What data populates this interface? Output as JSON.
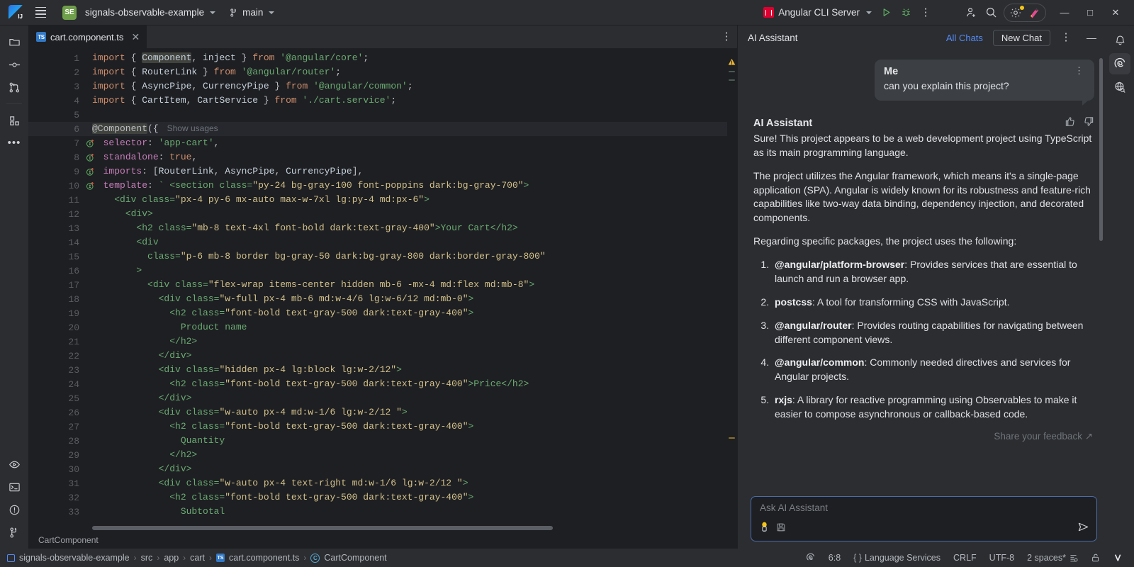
{
  "titlebar": {
    "logo_icon": "intellij-logo-icon",
    "menu_icon": "hamburger-menu-icon",
    "project_badge": "SE",
    "project_name": "signals-observable-example",
    "branch_icon": "git-branch-icon",
    "branch_name": "main",
    "run_config_icon": "angular-icon",
    "run_config": "Angular CLI Server",
    "run_icon": "run-play-icon",
    "debug_icon": "debug-bug-icon",
    "more_icon": "more-vertical-icon",
    "add_user_icon": "add-user-icon",
    "search_icon": "search-icon",
    "settings_icon": "gear-icon",
    "ai_icon": "ai-assistant-icon",
    "minimize": "—",
    "maximize": "□",
    "close": "✕"
  },
  "left_strip": {
    "items": [
      {
        "name": "project-tool-icon",
        "icon": "folder-icon"
      },
      {
        "name": "commit-tool-icon",
        "icon": "commit-node-icon"
      },
      {
        "name": "pull-requests-tool-icon",
        "icon": "pull-request-icon"
      },
      {
        "name": "structure-tool-icon",
        "icon": "structure-blocks-icon"
      },
      {
        "name": "more-tools-icon",
        "icon": "ellipsis-icon"
      }
    ],
    "bottom_items": [
      {
        "name": "run-tool-icon",
        "icon": "run-window-icon"
      },
      {
        "name": "terminal-tool-icon",
        "icon": "terminal-icon"
      },
      {
        "name": "problems-tool-icon",
        "icon": "warning-circle-icon"
      },
      {
        "name": "version-control-tool-icon",
        "icon": "branch-icon"
      }
    ]
  },
  "editor": {
    "tab": {
      "icon": "typescript-file-icon",
      "icon_label": "TS",
      "filename": "cart.component.ts",
      "close": "✕"
    },
    "tab_options_icon": "more-vertical-icon",
    "show_usages": "Show usages",
    "lines": [
      {
        "n": 1,
        "gutter": "",
        "html": "<span class='kw'>import</span><span class='punc'> { </span><span class='id comp-hl'>Component</span><span class='punc'>, </span><span class='id'>inject</span><span class='punc'> } </span><span class='kw'>from</span> <span class='str'>'@angular/core'</span><span class='punc'>;</span>"
      },
      {
        "n": 2,
        "gutter": "",
        "html": "<span class='kw'>import</span><span class='punc'> { </span><span class='id'>RouterLink</span><span class='punc'> } </span><span class='kw'>from</span> <span class='str'>'@angular/router'</span><span class='punc'>;</span>"
      },
      {
        "n": 3,
        "gutter": "",
        "html": "<span class='kw'>import</span><span class='punc'> { </span><span class='id'>AsyncPipe</span><span class='punc'>, </span><span class='id'>CurrencyPipe</span><span class='punc'> } </span><span class='kw'>from</span> <span class='str'>'@angular/common'</span><span class='punc'>;</span>"
      },
      {
        "n": 4,
        "gutter": "",
        "html": "<span class='kw'>import</span><span class='punc'> { </span><span class='id'>CartItem</span><span class='punc'>, </span><span class='id'>CartService</span><span class='punc'> } </span><span class='kw'>from</span> <span class='str'>'./cart.service'</span><span class='punc'>;</span>"
      },
      {
        "n": 5,
        "gutter": "",
        "html": ""
      },
      {
        "n": 6,
        "gutter": "",
        "html": "<span class='comp-hl' style='color:#bcbec4'>@Component</span><span class='punc'>({</span>",
        "usages": true,
        "highlight": true
      },
      {
        "n": 7,
        "gutter": "impl",
        "html": "  <span class='prop'>selector</span><span class='punc'>: </span><span class='str'>'app-cart'</span><span class='punc'>,</span>"
      },
      {
        "n": 8,
        "gutter": "impl",
        "html": "  <span class='prop'>standalone</span><span class='punc'>: </span><span class='kw'>true</span><span class='punc'>,</span>"
      },
      {
        "n": 9,
        "gutter": "impl",
        "html": "  <span class='prop'>imports</span><span class='punc'>: [</span><span class='id'>RouterLink</span><span class='punc'>, </span><span class='id'>AsyncPipe</span><span class='punc'>, </span><span class='id'>CurrencyPipe</span><span class='punc'>],</span>"
      },
      {
        "n": 10,
        "gutter": "impl",
        "html": "  <span class='prop'>template</span><span class='punc'>: </span><span class='str'>` </span><span class='tmpl'>&lt;section class=</span><span class='tmplattr'>\"py-24 bg-gray-100 font-poppins dark:bg-gray-700\"</span><span class='tmpl'>&gt;</span>"
      },
      {
        "n": 11,
        "gutter": "",
        "html": "    <span class='tmpl'>&lt;div class=</span><span class='tmplattr'>\"px-4 py-6 mx-auto max-w-7xl lg:py-4 md:px-6\"</span><span class='tmpl'>&gt;</span>"
      },
      {
        "n": 12,
        "gutter": "",
        "html": "      <span class='tmpl'>&lt;div&gt;</span>"
      },
      {
        "n": 13,
        "gutter": "",
        "html": "        <span class='tmpl'>&lt;h2 class=</span><span class='tmplattr'>\"mb-8 text-4xl font-bold dark:text-gray-400\"</span><span class='tmpl'>&gt;Your Cart&lt;/h2&gt;</span>"
      },
      {
        "n": 14,
        "gutter": "",
        "html": "        <span class='tmpl'>&lt;div</span>"
      },
      {
        "n": 15,
        "gutter": "",
        "html": "          <span class='tmpl'>class=</span><span class='tmplattr'>\"p-6 mb-8 border bg-gray-50 dark:bg-gray-800 dark:border-gray-800\"</span>"
      },
      {
        "n": 16,
        "gutter": "",
        "html": "        <span class='tmpl'>&gt;</span>"
      },
      {
        "n": 17,
        "gutter": "",
        "html": "          <span class='tmpl'>&lt;div class=</span><span class='tmplattr'>\"flex-wrap items-center hidden mb-6 -mx-4 md:flex md:mb-8\"</span><span class='tmpl'>&gt;</span>"
      },
      {
        "n": 18,
        "gutter": "",
        "html": "            <span class='tmpl'>&lt;div class=</span><span class='tmplattr'>\"w-full px-4 mb-6 md:w-4/6 lg:w-6/12 md:mb-0\"</span><span class='tmpl'>&gt;</span>"
      },
      {
        "n": 19,
        "gutter": "",
        "html": "              <span class='tmpl'>&lt;h2 class=</span><span class='tmplattr'>\"font-bold text-gray-500 dark:text-gray-400\"</span><span class='tmpl'>&gt;</span>"
      },
      {
        "n": 20,
        "gutter": "",
        "html": "                <span class='tmpl'>Product name</span>"
      },
      {
        "n": 21,
        "gutter": "",
        "html": "              <span class='tmpl'>&lt;/h2&gt;</span>"
      },
      {
        "n": 22,
        "gutter": "",
        "html": "            <span class='tmpl'>&lt;/div&gt;</span>"
      },
      {
        "n": 23,
        "gutter": "",
        "html": "            <span class='tmpl'>&lt;div class=</span><span class='tmplattr'>\"hidden px-4 lg:block lg:w-2/12\"</span><span class='tmpl'>&gt;</span>"
      },
      {
        "n": 24,
        "gutter": "",
        "html": "              <span class='tmpl'>&lt;h2 class=</span><span class='tmplattr'>\"font-bold text-gray-500 dark:text-gray-400\"</span><span class='tmpl'>&gt;Price&lt;/h2&gt;</span>"
      },
      {
        "n": 25,
        "gutter": "",
        "html": "            <span class='tmpl'>&lt;/div&gt;</span>"
      },
      {
        "n": 26,
        "gutter": "",
        "html": "            <span class='tmpl'>&lt;div class=</span><span class='tmplattr'>\"w-auto px-4 md:w-1/6 lg:w-2/12 \"</span><span class='tmpl'>&gt;</span>"
      },
      {
        "n": 27,
        "gutter": "",
        "html": "              <span class='tmpl'>&lt;h2 class=</span><span class='tmplattr'>\"font-bold text-gray-500 dark:text-gray-400\"</span><span class='tmpl'>&gt;</span>"
      },
      {
        "n": 28,
        "gutter": "",
        "html": "                <span class='tmpl'>Quantity</span>"
      },
      {
        "n": 29,
        "gutter": "",
        "html": "              <span class='tmpl'>&lt;/h2&gt;</span>"
      },
      {
        "n": 30,
        "gutter": "",
        "html": "            <span class='tmpl'>&lt;/div&gt;</span>"
      },
      {
        "n": 31,
        "gutter": "",
        "html": "            <span class='tmpl'>&lt;div class=</span><span class='tmplattr'>\"w-auto px-4 text-right md:w-1/6 lg:w-2/12 \"</span><span class='tmpl'>&gt;</span>"
      },
      {
        "n": 32,
        "gutter": "",
        "html": "              <span class='tmpl'>&lt;h2 class=</span><span class='tmplattr'>\"font-bold text-gray-500 dark:text-gray-400\"</span><span class='tmpl'>&gt;</span>"
      },
      {
        "n": 33,
        "gutter": "",
        "html": "                <span class='tmpl'>Subtotal</span>"
      }
    ],
    "breadcrumb_class": "CartComponent"
  },
  "ai": {
    "panel_title": "AI Assistant",
    "all_chats": "All Chats",
    "new_chat": "New Chat",
    "options_icon": "more-vertical-icon",
    "minimize_icon": "minimize-icon",
    "user_message": {
      "author": "Me",
      "text": "can you explain this project?",
      "options_icon": "more-vertical-icon"
    },
    "assistant": {
      "author": "AI Assistant",
      "thumbs_up_icon": "thumbs-up-icon",
      "thumbs_down_icon": "thumbs-down-icon",
      "paragraph1": "Sure! This project appears to be a web development project using TypeScript as its main programming language.",
      "paragraph2": "The project utilizes the Angular framework, which means it's a single-page application (SPA). Angular is widely known for its robustness and feature-rich capabilities like two-way data binding, dependency injection, and decorated components.",
      "paragraph3": "Regarding specific packages, the project uses the following:",
      "packages": [
        {
          "name": "@angular/platform-browser",
          "desc": ": Provides services that are essential to launch and run a browser app."
        },
        {
          "name": "postcss",
          "desc": ": A tool for transforming CSS with JavaScript."
        },
        {
          "name": "@angular/router",
          "desc": ": Provides routing capabilities for navigating between different component views."
        },
        {
          "name": "@angular/common",
          "desc": ": Commonly needed directives and services for Angular projects."
        },
        {
          "name": "rxjs",
          "desc": ": A library for reactive programming using Observables to make it easier to compose asynchronous or callback-based code."
        }
      ],
      "feedback": "Share your feedback ↗"
    },
    "input": {
      "placeholder": "Ask AI Assistant",
      "bulb_icon": "lightbulb-icon",
      "save_icon": "save-icon",
      "send_icon": "send-arrow-icon"
    }
  },
  "right_strip": {
    "items": [
      {
        "name": "notifications-icon",
        "icon": "bell-icon",
        "active": false
      },
      {
        "name": "ai-assistant-tool-icon",
        "icon": "ai-spiral-icon",
        "active": true
      },
      {
        "name": "web-search-tool-icon",
        "icon": "globe-search-icon",
        "active": false
      }
    ]
  },
  "status_bar": {
    "breadcrumb": [
      {
        "label": "signals-observable-example",
        "icon": "project-icon"
      },
      {
        "label": "src",
        "icon": ""
      },
      {
        "label": "app",
        "icon": ""
      },
      {
        "label": "cart",
        "icon": ""
      },
      {
        "label": "cart.component.ts",
        "icon": "typescript-file-icon"
      },
      {
        "label": "CartComponent",
        "icon": "class-icon"
      }
    ],
    "separator": "›",
    "ai_icon": "ai-spiral-icon",
    "caret": "6:8",
    "language_services": "Language Services",
    "line_separator": "CRLF",
    "encoding": "UTF-8",
    "indent": "2 spaces*",
    "indent_icon": "indent-icon",
    "lock_icon": "unlocked-icon",
    "ide_icon": "checkmark-icon"
  }
}
